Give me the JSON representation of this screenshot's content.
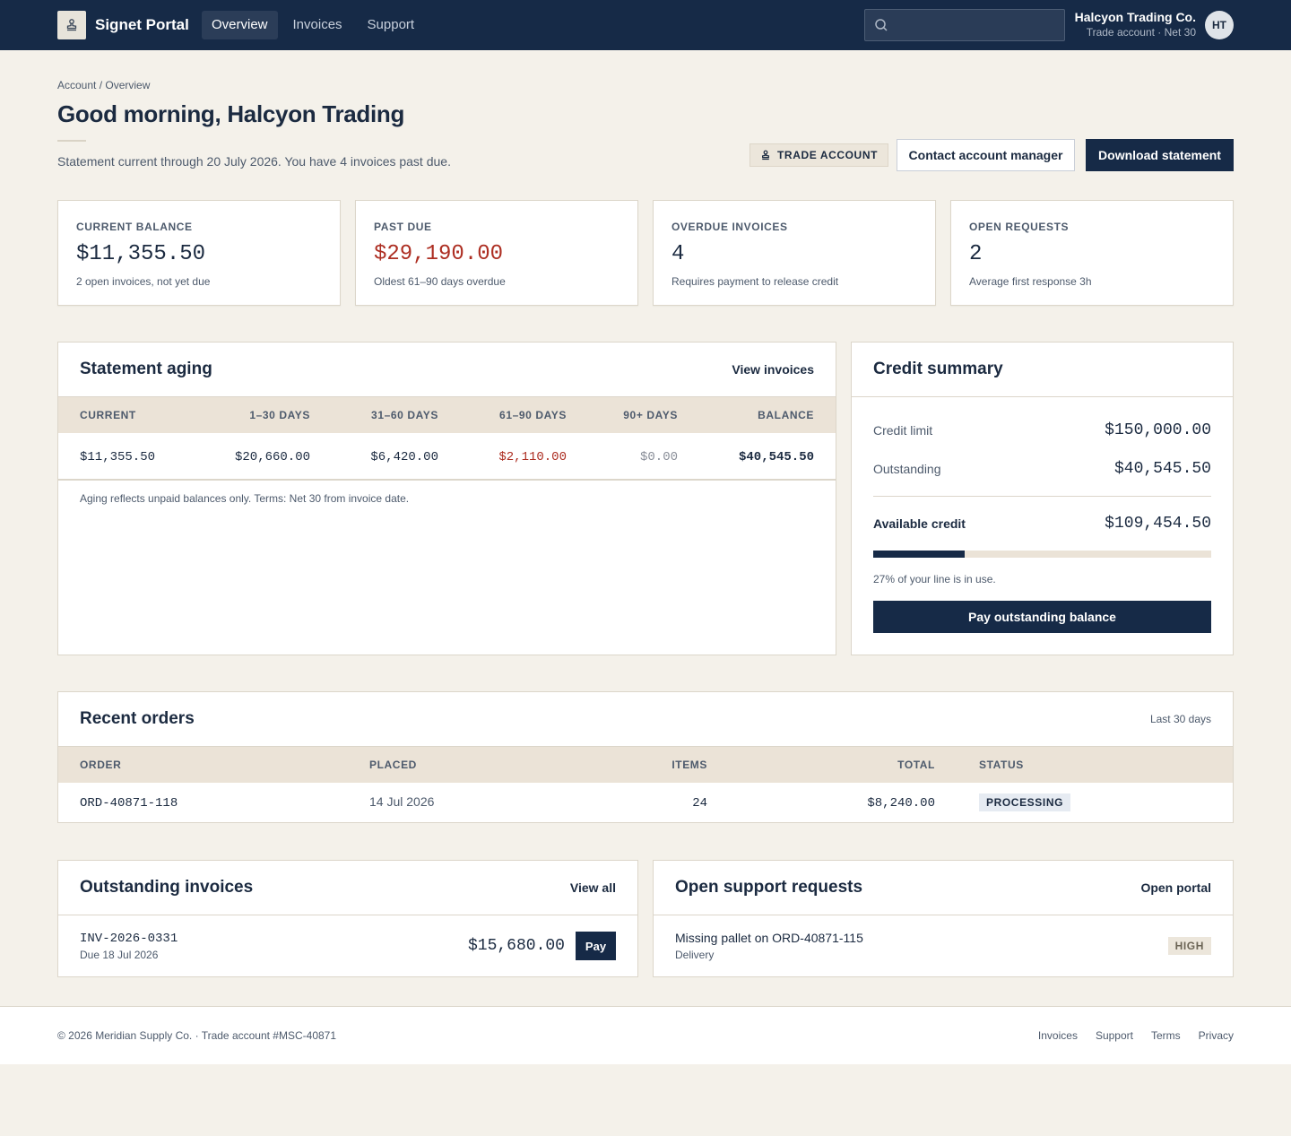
{
  "header": {
    "brand": "Signet Portal",
    "nav": [
      {
        "label": "Overview",
        "active": true
      },
      {
        "label": "Invoices",
        "active": false
      },
      {
        "label": "Support",
        "active": false
      }
    ],
    "search_placeholder": "",
    "account_name": "Halcyon Trading Co.",
    "account_sub": "Trade account · Net 30",
    "avatar_initials": "HT"
  },
  "page": {
    "breadcrumb": "Account / Overview",
    "title": "Good morning, Halcyon Trading",
    "subtitle": "Statement current through 20 July 2026. You have 4 invoices past due.",
    "trade_badge": "TRADE ACCOUNT",
    "contact_button": "Contact account manager",
    "download_button": "Download statement"
  },
  "kpis": [
    {
      "label": "CURRENT BALANCE",
      "value": "$11,355.50",
      "note": "2 open invoices, not yet due",
      "alert": false
    },
    {
      "label": "PAST DUE",
      "value": "$29,190.00",
      "note": "Oldest 61–90 days overdue",
      "alert": true
    },
    {
      "label": "OVERDUE INVOICES",
      "value": "4",
      "note": "Requires payment to release credit",
      "alert": false
    },
    {
      "label": "OPEN REQUESTS",
      "value": "2",
      "note": "Average first response 3h",
      "alert": false
    }
  ],
  "aging": {
    "title": "Statement aging",
    "link": "View invoices",
    "columns": [
      "CURRENT",
      "1–30 DAYS",
      "31–60 DAYS",
      "61–90 DAYS",
      "90+ DAYS",
      "BALANCE"
    ],
    "values": [
      "$11,355.50",
      "$20,660.00",
      "$6,420.00",
      "$2,110.00",
      "$0.00",
      "$40,545.50"
    ],
    "note": "Aging reflects unpaid balances only. Terms: Net 30 from invoice date."
  },
  "credit": {
    "title": "Credit summary",
    "limit_label": "Credit limit",
    "limit_value": "$150,000.00",
    "outstanding_label": "Outstanding",
    "outstanding_value": "$40,545.50",
    "available_label": "Available credit",
    "available_value": "$109,454.50",
    "utilization": 0.27,
    "utilization_note": "27% of your line is in use.",
    "pay_button": "Pay outstanding balance"
  },
  "orders": {
    "title": "Recent orders",
    "range": "Last 30 days",
    "columns": [
      "ORDER",
      "PLACED",
      "ITEMS",
      "TOTAL",
      "STATUS"
    ],
    "rows": [
      {
        "order": "ORD-40871-118",
        "placed": "14 Jul 2026",
        "items": "24",
        "total": "$8,240.00",
        "status": "PROCESSING"
      }
    ]
  },
  "invoices": {
    "title": "Outstanding invoices",
    "link": "View all",
    "items": [
      {
        "id": "INV-2026-0331",
        "due": "Due 18 Jul 2026",
        "amount": "$15,680.00",
        "action": "Pay"
      }
    ]
  },
  "support": {
    "title": "Open support requests",
    "link": "Open portal",
    "items": [
      {
        "subject": "Missing pallet on ORD-40871-115",
        "category": "Delivery",
        "priority": "HIGH"
      }
    ]
  },
  "footer": {
    "copyright": "© 2026 Meridian Supply Co. · Trade account #MSC-40871",
    "links": [
      "Invoices",
      "Support",
      "Terms",
      "Privacy"
    ]
  },
  "colors": {
    "navy": "#162a47",
    "background": "#f4f1ea",
    "alert_red": "#ad2e22",
    "table_header": "#ebe3d7"
  }
}
